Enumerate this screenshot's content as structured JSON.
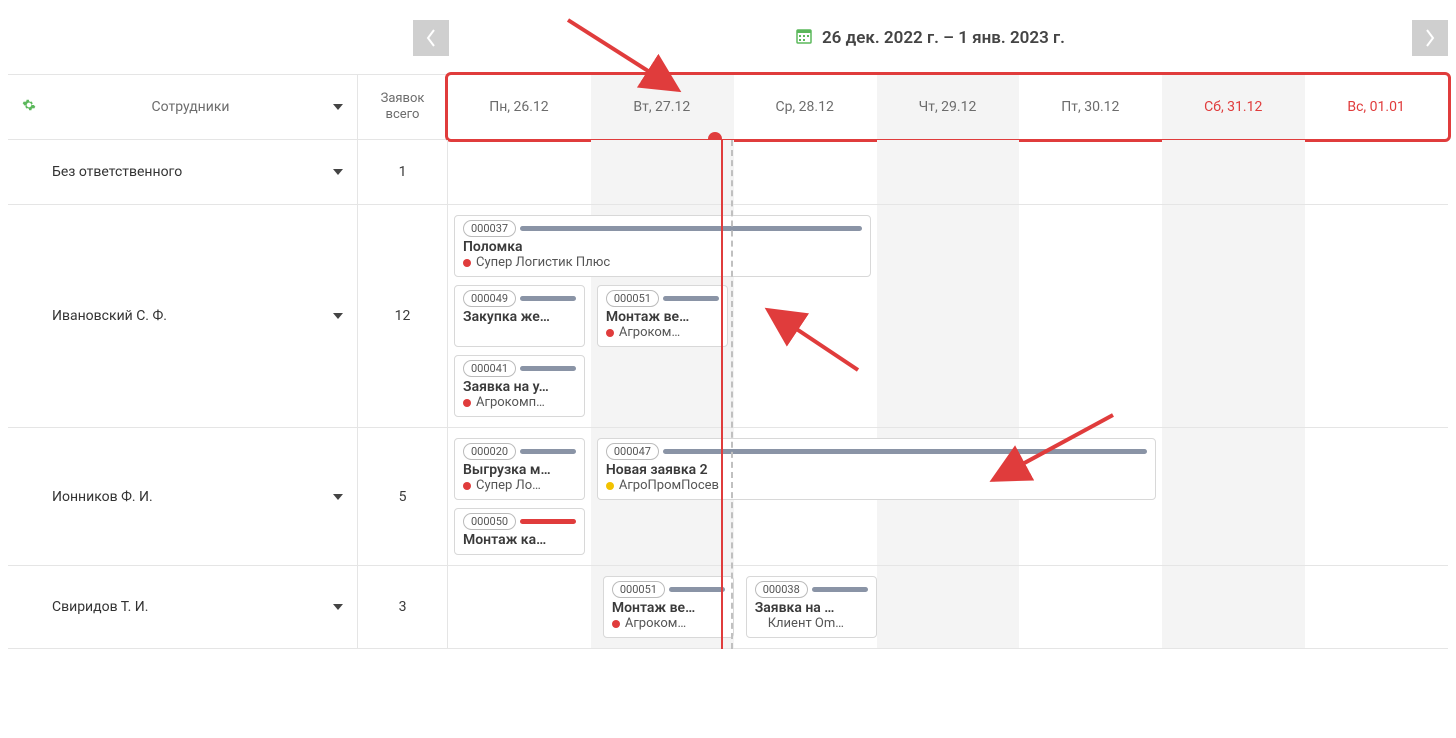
{
  "header": {
    "date_range": "26 дек. 2022 г. – 1 янв. 2023 г."
  },
  "columns": {
    "employees_title": "Сотрудники",
    "total_title": "Заявок всего"
  },
  "days": [
    {
      "label": "Пн, 26.12",
      "weekend": false,
      "shaded": false
    },
    {
      "label": "Вт, 27.12",
      "weekend": false,
      "shaded": true
    },
    {
      "label": "Ср, 28.12",
      "weekend": false,
      "shaded": false
    },
    {
      "label": "Чт, 29.12",
      "weekend": false,
      "shaded": true
    },
    {
      "label": "Пт, 30.12",
      "weekend": false,
      "shaded": false
    },
    {
      "label": "Сб, 31.12",
      "weekend": true,
      "shaded": true
    },
    {
      "label": "Вс, 01.01",
      "weekend": true,
      "shaded": false
    }
  ],
  "rows": [
    {
      "label": "Без ответственного",
      "count": "1",
      "tasks": []
    },
    {
      "label": "Ивановский С. Ф.",
      "count": "12",
      "tasks": [
        [
          {
            "id": "000037",
            "title": "Поломка",
            "client": "Супер Логистик Плюс",
            "dot": "red",
            "bar": "gray",
            "days": 3,
            "start": 0
          }
        ],
        [
          {
            "id": "000049",
            "title": "Закупка же…",
            "client": "",
            "dot": "none",
            "bar": "gray",
            "days": 1,
            "start": 0
          },
          {
            "id": "000051",
            "title": "Монтаж ве…",
            "client": "Агроком…",
            "dot": "red",
            "bar": "gray",
            "days": 1,
            "start": 1
          }
        ],
        [
          {
            "id": "000041",
            "title": "Заявка на у…",
            "client": "Агрокомп…",
            "dot": "red",
            "bar": "gray",
            "days": 1,
            "start": 0
          }
        ]
      ]
    },
    {
      "label": "Ионников Ф. И.",
      "count": "5",
      "tasks": [
        [
          {
            "id": "000020",
            "title": "Выгрузка м…",
            "client": "Супер Ло…",
            "dot": "red",
            "bar": "gray",
            "days": 1,
            "start": 0
          },
          {
            "id": "000047",
            "title": "Новая заявка 2",
            "client": "АгроПромПосев",
            "dot": "yellow",
            "bar": "gray",
            "days": 4,
            "start": 1
          }
        ],
        [
          {
            "id": "000050",
            "title": "Монтаж ка…",
            "client": "",
            "dot": "none",
            "bar": "red",
            "days": 1,
            "start": 0
          }
        ]
      ]
    },
    {
      "label": "Свиридов Т. И.",
      "count": "3",
      "tasks": [
        [
          {
            "id": "000051",
            "title": "Монтаж ве…",
            "client": "Агроком…",
            "dot": "red",
            "bar": "gray",
            "days": 1,
            "start": 1
          },
          {
            "id": "000038",
            "title": "Заявка на …",
            "client": "Клиент Om…",
            "dot": "none",
            "bar": "gray",
            "days": 1,
            "start": 2
          }
        ]
      ]
    }
  ],
  "now_position_day_fraction": 1.91
}
